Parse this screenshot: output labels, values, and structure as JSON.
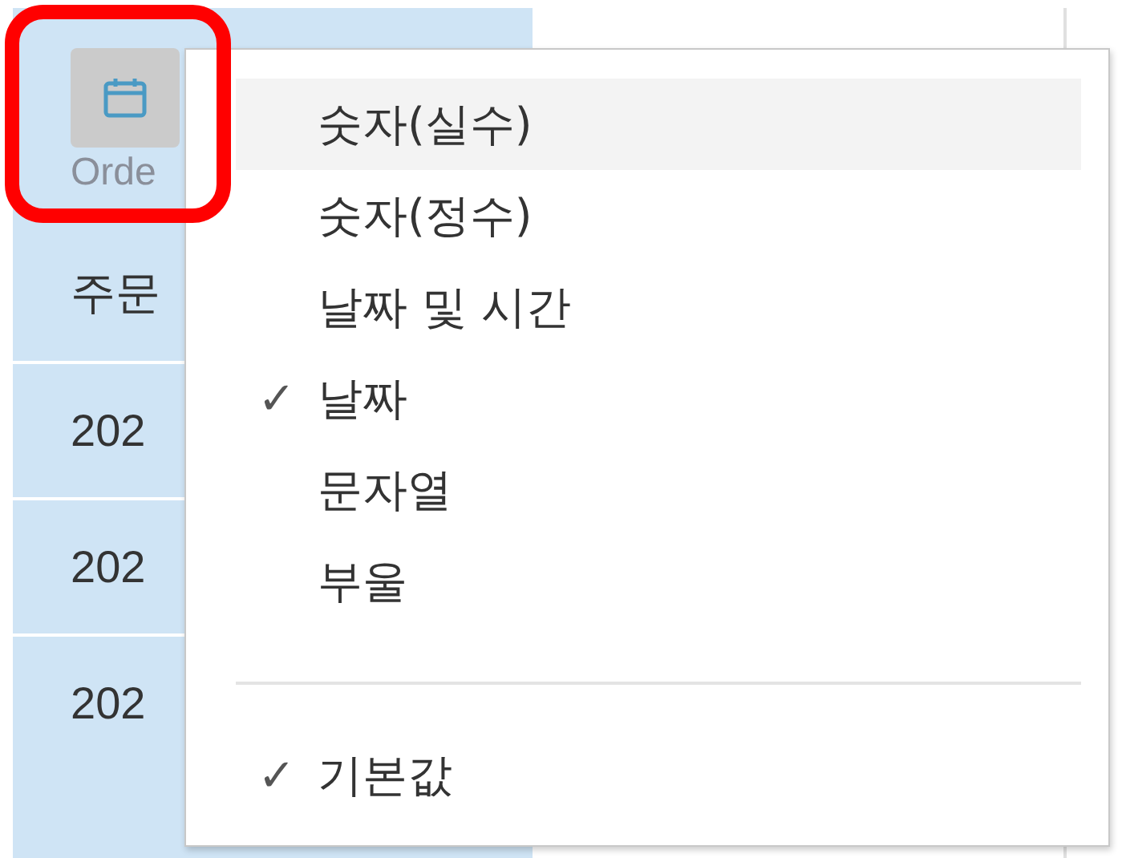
{
  "column": {
    "header_label": "Orde",
    "cells": [
      "주문",
      "202",
      "202",
      "202"
    ]
  },
  "menu": {
    "items": [
      {
        "label": "숫자(실수)",
        "checked": false,
        "hovered": true
      },
      {
        "label": "숫자(정수)",
        "checked": false,
        "hovered": false
      },
      {
        "label": "날짜 및 시간",
        "checked": false,
        "hovered": false
      },
      {
        "label": "날짜",
        "checked": true,
        "hovered": false
      },
      {
        "label": "문자열",
        "checked": false,
        "hovered": false
      },
      {
        "label": "부울",
        "checked": false,
        "hovered": false
      }
    ],
    "footer_items": [
      {
        "label": "기본값",
        "checked": true
      }
    ],
    "check_mark": "✓"
  }
}
